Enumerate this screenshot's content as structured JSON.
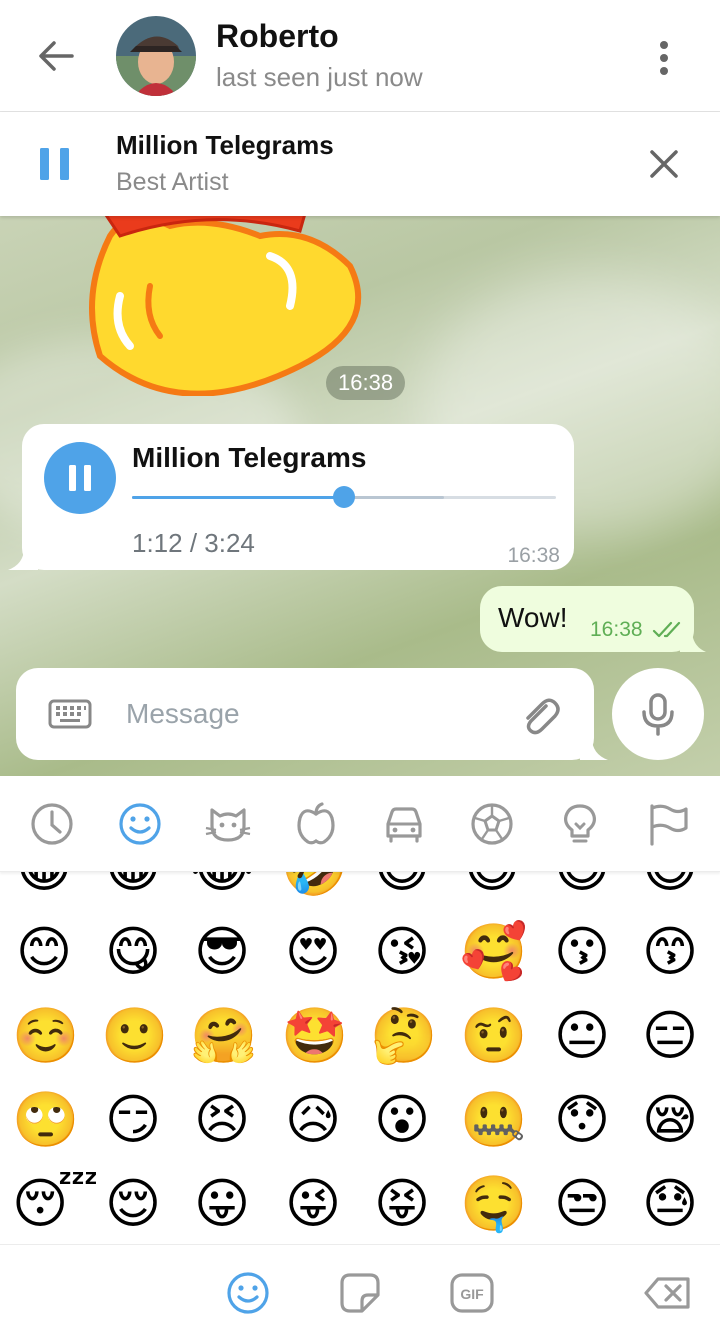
{
  "header": {
    "title": "Roberto",
    "status": "last seen just now",
    "icons": {
      "back": "arrow-left-icon",
      "menu": "more-vert-icon"
    }
  },
  "player": {
    "title": "Million Telegrams",
    "subtitle": "Best Artist",
    "state": "playing",
    "icons": {
      "pause": "pause-icon",
      "close": "close-icon"
    }
  },
  "messages": [
    {
      "type": "sticker",
      "time": "16:38"
    },
    {
      "type": "audio",
      "title": "Million Telegrams",
      "duration_text": "1:12 / 3:24",
      "progress": 0.5,
      "buffered": 0.735,
      "time": "16:38"
    },
    {
      "type": "text",
      "text": "Wow!",
      "time": "16:38",
      "outgoing": true,
      "status": "read"
    }
  ],
  "composer": {
    "placeholder": "Message",
    "value": "",
    "icons": {
      "keyboard": "keyboard-icon",
      "attach": "paperclip-icon",
      "mic": "microphone-icon"
    }
  },
  "emoji_panel": {
    "categories": [
      "recent-icon",
      "smileys-icon",
      "animals-icon",
      "food-icon",
      "travel-icon",
      "activity-icon",
      "objects-icon",
      "flags-icon"
    ],
    "selected_category": "smileys-icon",
    "rows": [
      [
        "😀",
        "😁",
        "😂",
        "🤣",
        "😃",
        "😄",
        "😅",
        "😆"
      ],
      [
        "😊",
        "😋",
        "😎",
        "😍",
        "😘",
        "🥰",
        "😗",
        "😙"
      ],
      [
        "☺️",
        "🙂",
        "🤗",
        "🤩",
        "🤔",
        "🤨",
        "😐",
        "😑"
      ],
      [
        "🙄",
        "😏",
        "😣",
        "😥",
        "😮",
        "🤐",
        "😯",
        "😪"
      ],
      [
        "😴",
        "😌",
        "😛",
        "😜",
        "😝",
        "🤤",
        "😒",
        "😓"
      ]
    ],
    "bottom_tabs": [
      "emoji-icon",
      "sticker-icon",
      "gif-icon"
    ],
    "backspace": "backspace-icon"
  },
  "colors": {
    "accent": "#4fa3e8",
    "outgoing_bubble": "#effdde",
    "read_check": "#5fae55"
  }
}
